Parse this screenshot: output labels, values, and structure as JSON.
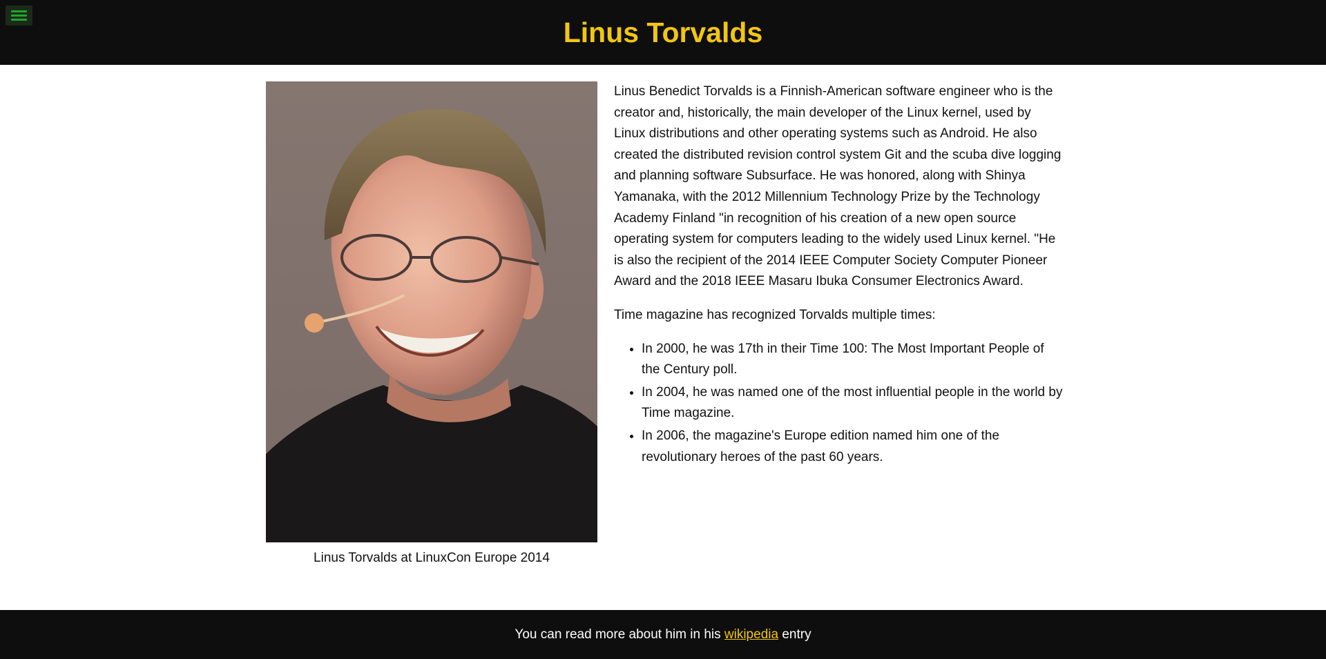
{
  "header": {
    "title": "Linus Torvalds",
    "menu_icon": "hamburger-menu-icon"
  },
  "figure": {
    "caption": "Linus Torvalds at LinuxCon Europe 2014"
  },
  "main": {
    "bio": "Linus Benedict Torvalds is a Finnish-American software engineer who is the creator and, historically, the main developer of the Linux kernel, used by Linux distributions and other operating systems such as Android. He also created the distributed revision control system Git and the scuba dive logging and planning software Subsurface. He was honored, along with Shinya Yamanaka, with the 2012 Millennium Technology Prize by the Technology Academy Finland \"in recognition of his creation of a new open source operating system for computers leading to the widely used Linux kernel. \"He is also the recipient of the 2014 IEEE Computer Society Computer Pioneer Award and the 2018 IEEE Masaru Ibuka Consumer Electronics Award.",
    "time_intro": "Time magazine has recognized Torvalds multiple times:",
    "time_items": [
      "In 2000, he was 17th in their Time 100: The Most Important People of the Century poll.",
      "In 2004, he was named one of the most influential people in the world by Time magazine.",
      "In 2006, the magazine's Europe edition named him one of the revolutionary heroes of the past 60 years."
    ]
  },
  "footer": {
    "prefix": "You can read more about him in his ",
    "link_label": "wikipedia",
    "suffix": " entry"
  },
  "colors": {
    "header_bg": "#0e0e0e",
    "accent": "#f2c511",
    "menu_icon": "#1fa82a"
  }
}
